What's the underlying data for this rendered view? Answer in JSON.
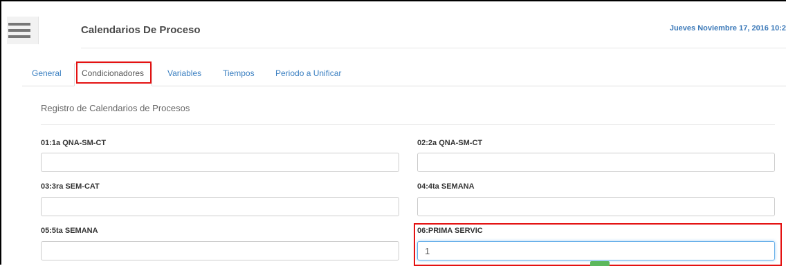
{
  "header": {
    "title": "Calendarios De Proceso",
    "datetime": "Jueves Noviembre 17, 2016 10:2",
    "menu_icon": "hamburger-menu-icon"
  },
  "tabs": [
    {
      "label": "General",
      "active": false
    },
    {
      "label": "Condicionadores",
      "active": true
    },
    {
      "label": "Variables",
      "active": false
    },
    {
      "label": "Tiempos",
      "active": false
    },
    {
      "label": "Periodo a Unificar",
      "active": false
    }
  ],
  "section": {
    "title": "Registro de Calendarios de Procesos"
  },
  "fields": [
    {
      "label": "01:1a QNA-SM-CT",
      "value": ""
    },
    {
      "label": "02:2a QNA-SM-CT",
      "value": ""
    },
    {
      "label": "03:3ra SEM-CAT",
      "value": ""
    },
    {
      "label": "04:4ta SEMANA",
      "value": ""
    },
    {
      "label": "05:5ta SEMANA",
      "value": ""
    },
    {
      "label": "06:PRIMA SERVIC",
      "value": "1"
    }
  ],
  "colors": {
    "highlight": "#e41111",
    "link": "#3a7fc1",
    "datetime": "#3a78b8",
    "focus": "#66afe9",
    "badge": "#5cb85c"
  }
}
